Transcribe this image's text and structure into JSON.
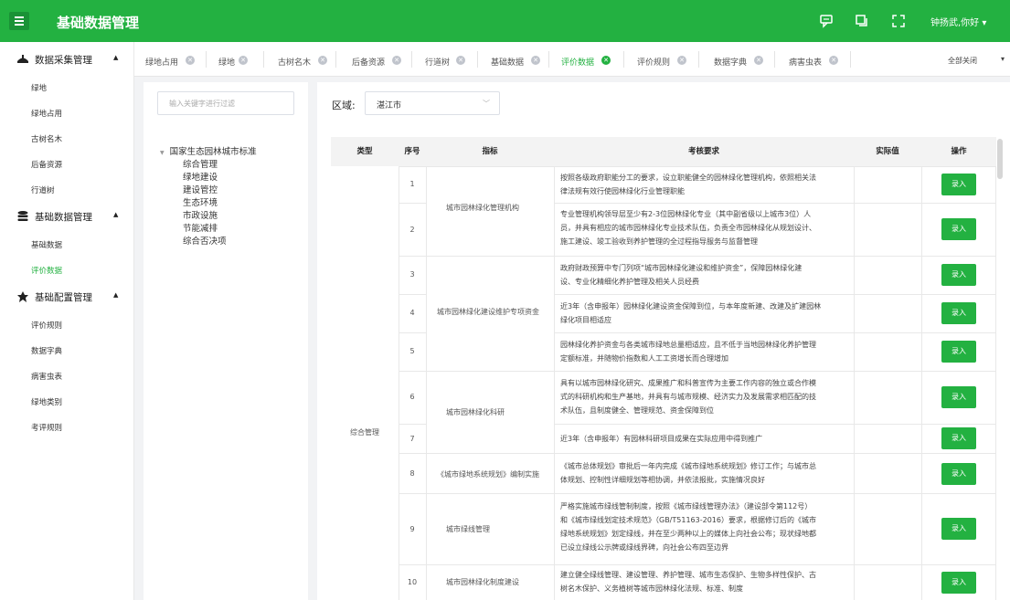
{
  "header": {
    "title": "基础数据管理",
    "user": "钟扬武,你好 ▾",
    "icons": [
      "hamburger-icon",
      "message-icon",
      "copy-icon",
      "fullscreen-icon"
    ]
  },
  "sidebar": {
    "groups": [
      {
        "label": "数据采集管理",
        "items": [
          "绿地",
          "绿地占用",
          "古树名木",
          "后备资源",
          "行道树"
        ]
      },
      {
        "label": "基础数据管理",
        "items": [
          "基础数据",
          "评价数据"
        ]
      },
      {
        "label": "基础配置管理",
        "items": [
          "评价规则",
          "数据字典",
          "病害虫表",
          "绿地类别",
          "考评规则"
        ]
      }
    ],
    "active_item": "评价数据"
  },
  "tabs": {
    "items": [
      "绿地占用",
      "绿地",
      "古树名木",
      "后备资源",
      "行道树",
      "基础数据",
      "评价数据",
      "评价规则",
      "数据字典",
      "病害虫表"
    ],
    "active": "评价数据",
    "close_all": "全部关闭"
  },
  "filter": {
    "placeholder": "输入关键字进行过滤",
    "tree_root": "国家生态园林城市标准",
    "tree_children": [
      "综合管理",
      "绿地建设",
      "建设管控",
      "生态环境",
      "市政设施",
      "节能减排",
      "综合否决项"
    ]
  },
  "region": {
    "label": "区域:",
    "value": "湛江市"
  },
  "table": {
    "headers": {
      "type": "类型",
      "index": "序号",
      "indicator": "指标",
      "requirement": "考核要求",
      "actual": "实际值",
      "action": "操作"
    },
    "type_value": "综合管理",
    "button_label": "录入",
    "indicators": [
      {
        "name": "城市园林绿化管理机构"
      },
      {
        "name": "城市园林绿化建设维护专项资金"
      },
      {
        "name": "城市园林绿化科研"
      },
      {
        "name": "《城市绿地系统规划》编制实施"
      },
      {
        "name": "城市绿线管理"
      },
      {
        "name": "城市园林绿化制度建设"
      }
    ],
    "rows": [
      {
        "index": "1",
        "lines": [
          "按照各级政府职能分工的要求，设立职能健全的园林绿化管理机构，依照相关法",
          "律法规有效行使园林绿化行业管理职能"
        ]
      },
      {
        "index": "2",
        "lines": [
          "专业管理机构领导层至少有2-3位园林绿化专业（其中副省级以上城市3位）人",
          "员，并具有相应的城市园林绿化专业技术队伍，负责全市园林绿化从规划设计、",
          "施工建设、竣工验收到养护管理的全过程指导服务与监督管理"
        ]
      },
      {
        "index": "3",
        "lines": [
          "政府财政预算中专门列项“城市园林绿化建设和维护资金”，保障园林绿化建",
          "设、专业化精细化养护管理及相关人员经费"
        ]
      },
      {
        "index": "4",
        "lines": [
          "近3年（含申报年）园林绿化建设资金保障到位，与本年度新建、改建及扩建园林",
          "绿化项目相适应"
        ]
      },
      {
        "index": "5",
        "lines": [
          "园林绿化养护资金与各类城市绿地总量相适应，且不低于当地园林绿化养护管理",
          "定额标准，并随物价指数和人工工资增长而合理增加"
        ]
      },
      {
        "index": "6",
        "lines": [
          "具有以城市园林绿化研究、成果推广和科普宣传为主要工作内容的独立或合作模",
          "式的科研机构和生产基地，并具有与城市规模、经济实力及发展需求相匹配的技",
          "术队伍，且制度健全、管理规范、资金保障到位"
        ]
      },
      {
        "index": "7",
        "lines": [
          "近3年（含申报年）有园林科研项目成果在实际应用中得到推广"
        ]
      },
      {
        "index": "8",
        "lines": [
          "《城市总体规划》审批后一年内完成《城市绿地系统规划》修订工作；与城市总",
          "体规划、控制性详细规划等相协调，并依法报批，实施情况良好"
        ]
      },
      {
        "index": "9",
        "lines": [
          "严格实施城市绿线管制制度，按照《城市绿线管理办法》（建设部令第112号）",
          "和《城市绿线划定技术规范》（GB/T51163-2016）要求，根据修订后的《城市",
          "绿地系统规划》划定绿线，并在至少两种以上的媒体上向社会公布；现状绿地都",
          "已设立绿线公示牌或绿线界碑，向社会公布四至边界"
        ]
      },
      {
        "index": "10",
        "lines": [
          "建立健全绿线管理、建设管理、养护管理、城市生态保护、生物多样性保护、古",
          "树名木保护、义务植树等城市园林绿化法规、标准、制度"
        ]
      }
    ]
  }
}
